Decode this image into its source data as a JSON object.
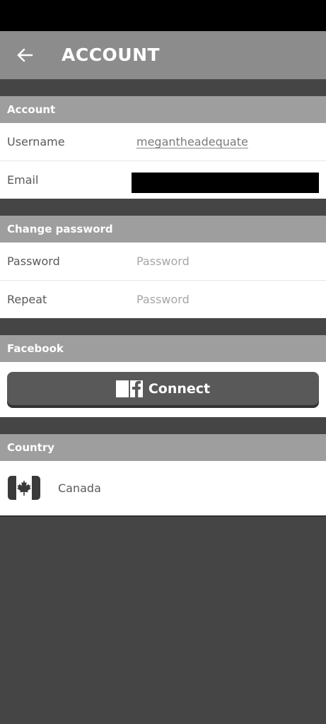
{
  "header": {
    "title": "ACCOUNT",
    "back_icon": "arrow-left-icon"
  },
  "account": {
    "section_title": "Account",
    "username_label": "Username",
    "username_value": "megantheadequate",
    "email_label": "Email"
  },
  "change_password": {
    "section_title": "Change password",
    "password_label": "Password",
    "password_placeholder": "Password",
    "repeat_label": "Repeat",
    "repeat_placeholder": "Password"
  },
  "facebook": {
    "section_title": "Facebook",
    "connect_label": "Connect",
    "logo_icon": "facebook-logo-icon"
  },
  "country": {
    "section_title": "Country",
    "name": "Canada",
    "flag_icon": "canada-flag-icon"
  },
  "colors": {
    "background": "#454545",
    "header": "#8c8c8c",
    "section_header": "#9e9e9e",
    "button": "#595959"
  }
}
